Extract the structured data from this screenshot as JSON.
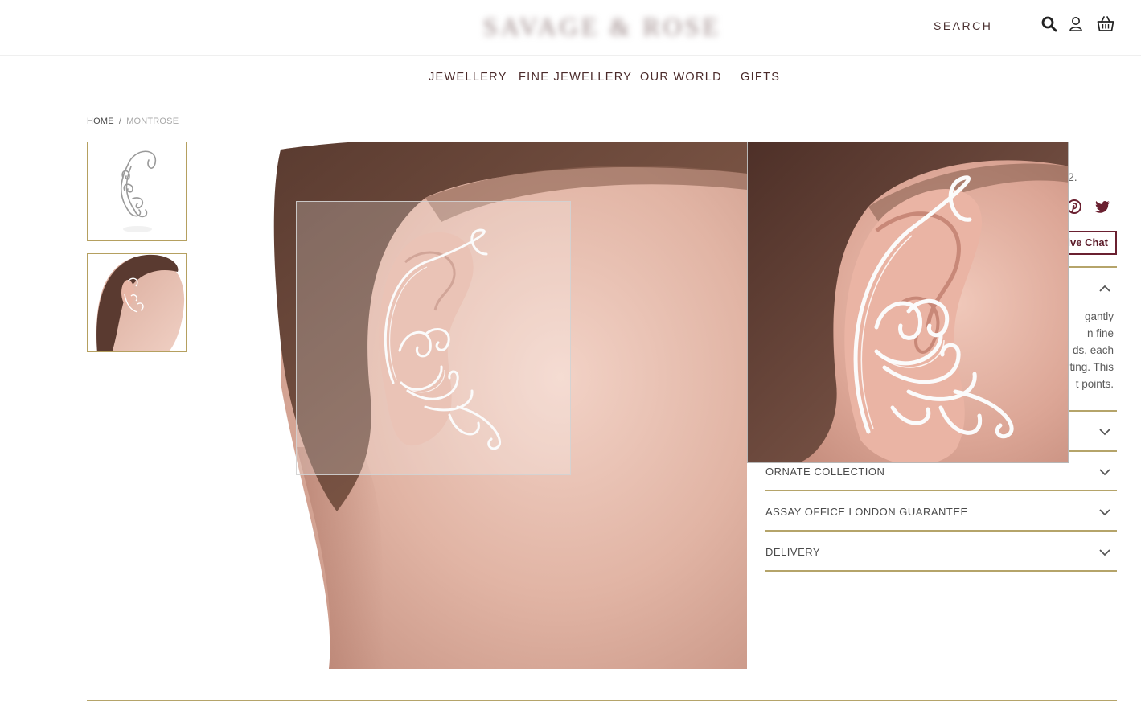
{
  "header": {
    "logo_text": "SAVAGE & ROSE",
    "search_label": "SEARCH",
    "icons": [
      "search-icon",
      "user-icon",
      "basket-icon"
    ]
  },
  "nav": {
    "items": [
      {
        "label": "JEWELLERY"
      },
      {
        "label": "FINE JEWELLERY"
      },
      {
        "label": "OUR WORLD"
      },
      {
        "label": "GIFTS"
      }
    ]
  },
  "breadcrumb": {
    "home": "HOME",
    "separator": "/",
    "current": "MONTROSE"
  },
  "product": {
    "price_fragment": "2.",
    "chat_label": "ive Chat",
    "social_icons": [
      "pinterest-icon",
      "twitter-icon"
    ],
    "description_fragments": [
      "gantly",
      "n fine",
      "ds, each",
      "ting. This",
      "t points."
    ]
  },
  "accordion": {
    "sections": [
      {
        "title": "ORNATE COLLECTION"
      },
      {
        "title": "ASSAY OFFICE LONDON GUARANTEE"
      },
      {
        "title": "DELIVERY"
      }
    ]
  },
  "colors": {
    "accent_gold": "#b5a46a",
    "brand_burgundy": "#6a2030",
    "nav_text": "#4a2a2a"
  }
}
